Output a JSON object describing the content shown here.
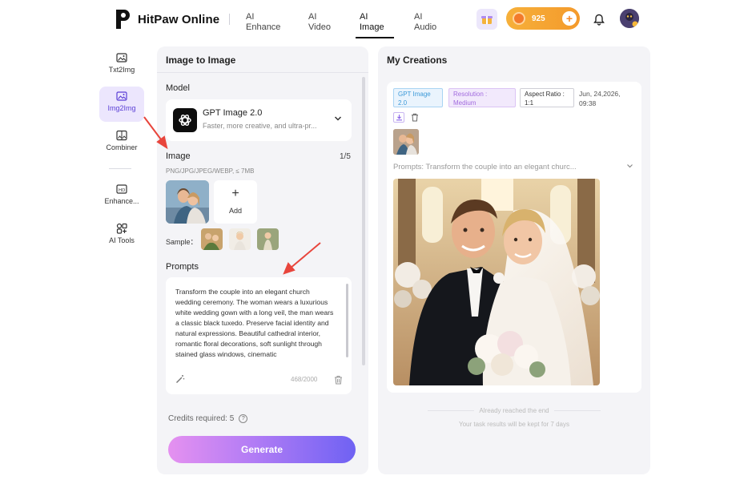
{
  "app": {
    "name": "HitPaw Online",
    "nav": [
      {
        "line1": "AI",
        "line2": "Enhance"
      },
      {
        "line1": "AI",
        "line2": "Video"
      },
      {
        "line1": "AI",
        "line2": "Image"
      },
      {
        "line1": "AI",
        "line2": "Audio"
      }
    ],
    "active_nav": "AI Image",
    "credits": "925",
    "icons": {
      "promo": "gift-icon",
      "credits": "coin-icon",
      "add": "plus-icon",
      "notifications": "bell-icon",
      "avatar": "avatar"
    }
  },
  "sidebar": {
    "items": [
      {
        "label": "Txt2Img",
        "icon": "image-icon"
      },
      {
        "label": "Img2Img",
        "icon": "image-swap-icon",
        "active": true
      },
      {
        "label": "Combiner",
        "icon": "combine-icon"
      },
      {
        "label": "Enhance...",
        "icon": "enhance-icon"
      },
      {
        "label": "AI Tools",
        "icon": "tools-icon"
      }
    ]
  },
  "left_panel": {
    "title": "Image to Image",
    "model_label": "Model",
    "model": {
      "name": "GPT Image 2.0",
      "description": "Faster, more creative, and ultra-pr..."
    },
    "image_label": "Image",
    "image_count": "1/5",
    "image_hint": "PNG/JPG/JPEG/WEBP, ≤ 7MB",
    "add_label": "Add",
    "sample_label": "Sample：",
    "prompts_label": "Prompts",
    "prompt_text": "Transform the couple into an elegant church wedding ceremony. The woman wears a luxurious white wedding gown with a long veil, the man wears a classic black tuxedo. Preserve facial identity and natural expressions. Beautiful cathedral interior, romantic floral decorations, soft sunlight through stained glass windows, cinematic",
    "char_count": "468/2000",
    "credits_required": "Credits required: 5",
    "generate_label": "Generate"
  },
  "right_panel": {
    "title": "My Creations",
    "tags": {
      "model": "GPT Image 2.0",
      "resolution": "Resolution : Medium",
      "aspect_ratio": "Aspect Ratio : 1:1"
    },
    "date_line1": "Jun, 24,2026,",
    "date_line2": "09:38",
    "prompt_summary": "Prompts: Transform the couple into an elegant churc...",
    "end_text": "Already reached the end",
    "keep_text": "Your task results will be kept for 7 days"
  },
  "colors": {
    "accent": "#6f62f3",
    "rail_active_bg": "#ece6fd",
    "credits_pill": "#f6b03a",
    "annotation_arrow": "#e8453c"
  }
}
